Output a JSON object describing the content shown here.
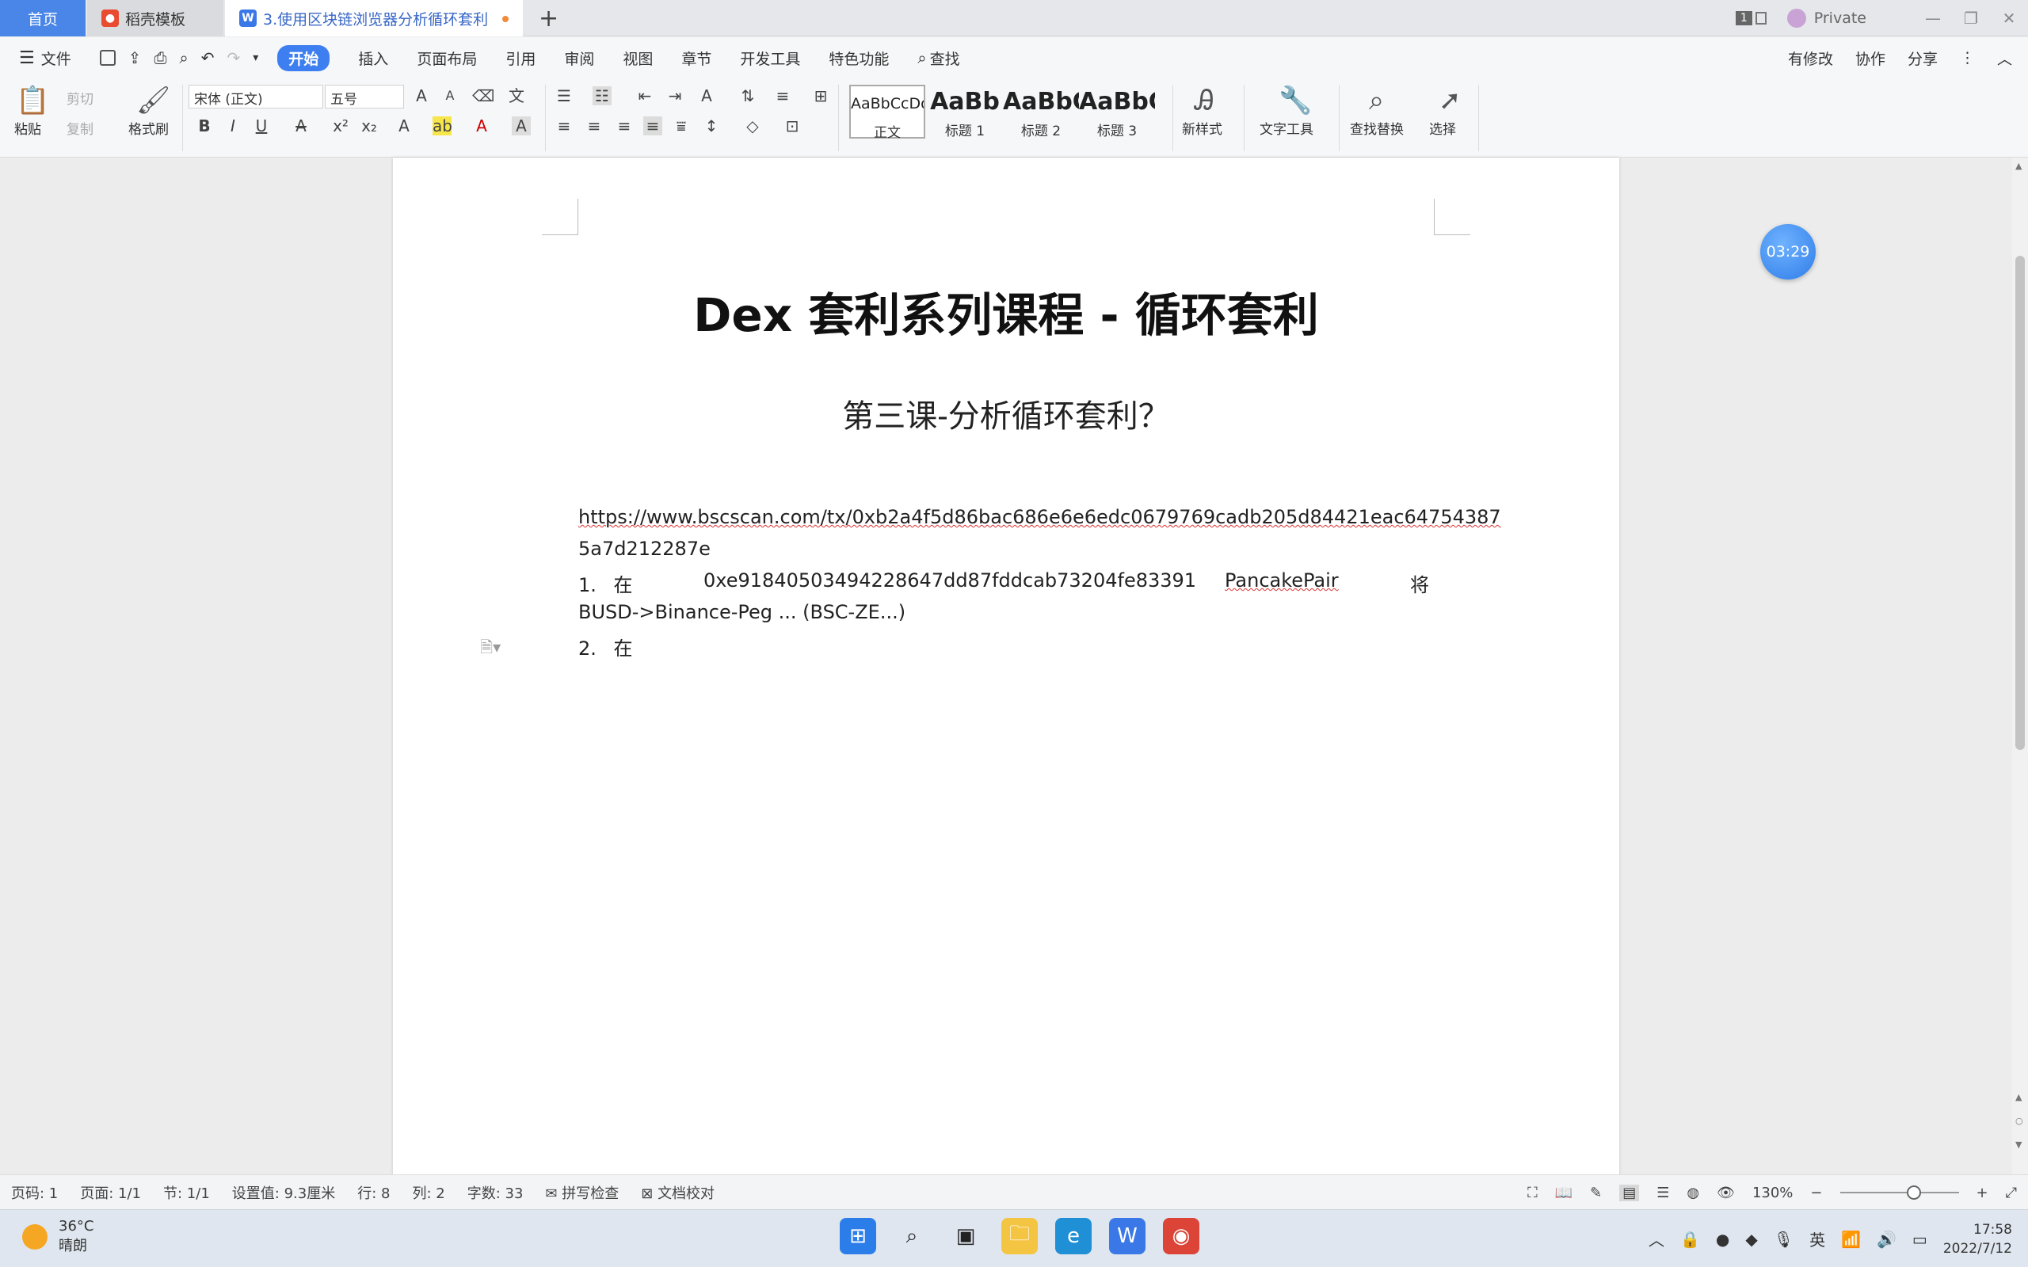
{
  "tabs": {
    "home": "首页",
    "daoke": "稻壳模板",
    "doc": "3.使用区块链浏览器分析循环套利",
    "add": "+"
  },
  "window": {
    "badge": "1",
    "user": "Private",
    "minimize": "—",
    "restore": "❐",
    "close": "✕"
  },
  "menubar": {
    "file": "文件",
    "items": [
      "开始",
      "插入",
      "页面布局",
      "引用",
      "审阅",
      "视图",
      "章节",
      "开发工具",
      "特色功能"
    ],
    "search": "查找",
    "right": [
      "有修改",
      "协作",
      "分享"
    ]
  },
  "ribbon": {
    "paste": "粘贴",
    "cut": "剪切",
    "copy": "复制",
    "format_painter": "格式刷",
    "font_name": "宋体 (正文)",
    "font_size": "五号",
    "styles": [
      {
        "sample": "AaBbCcDd",
        "name": "正文"
      },
      {
        "sample": "AaBb",
        "name": "标题 1"
      },
      {
        "sample": "AaBbC",
        "name": "标题 2"
      },
      {
        "sample": "AaBbC",
        "name": "标题 3"
      }
    ],
    "new_style": "新样式",
    "text_tools": "文字工具",
    "find_replace": "查找替换",
    "select": "选择"
  },
  "document": {
    "title": "Dex 套利系列课程 - 循环套利",
    "subtitle": "第三课-分析循环套利？",
    "url_line1": "https://www.bscscan.com/tx/0xb2a4f5d86bac686e6e6edc0679769cadb205d84421eac64754387",
    "url_line2": "5a7d212287e",
    "item1_num": "1.",
    "item1_a": "在",
    "item1_addr": "0xe91840503494228647dd87fddcab73204fe83391",
    "item1_pair": "PancakePair",
    "item1_b": "将",
    "item1_line2": "BUSD->Binance-Peg ...  (BSC-ZE...)",
    "item2_num": "2.",
    "item2_a": "在"
  },
  "timer": "03:29",
  "statusbar": {
    "page_num": "页码: 1",
    "pages": "页面: 1/1",
    "section": "节: 1/1",
    "setting": "设置值: 9.3厘米",
    "row": "行: 8",
    "col": "列: 2",
    "words": "字数: 33",
    "spell": "拼写检查",
    "proof": "文档校对",
    "zoom": "130%",
    "zoom_fraction": 0.62
  },
  "taskbar": {
    "temp": "36°C",
    "weather": "晴朗",
    "ime": "英",
    "time": "17:58",
    "date": "2022/7/12"
  }
}
